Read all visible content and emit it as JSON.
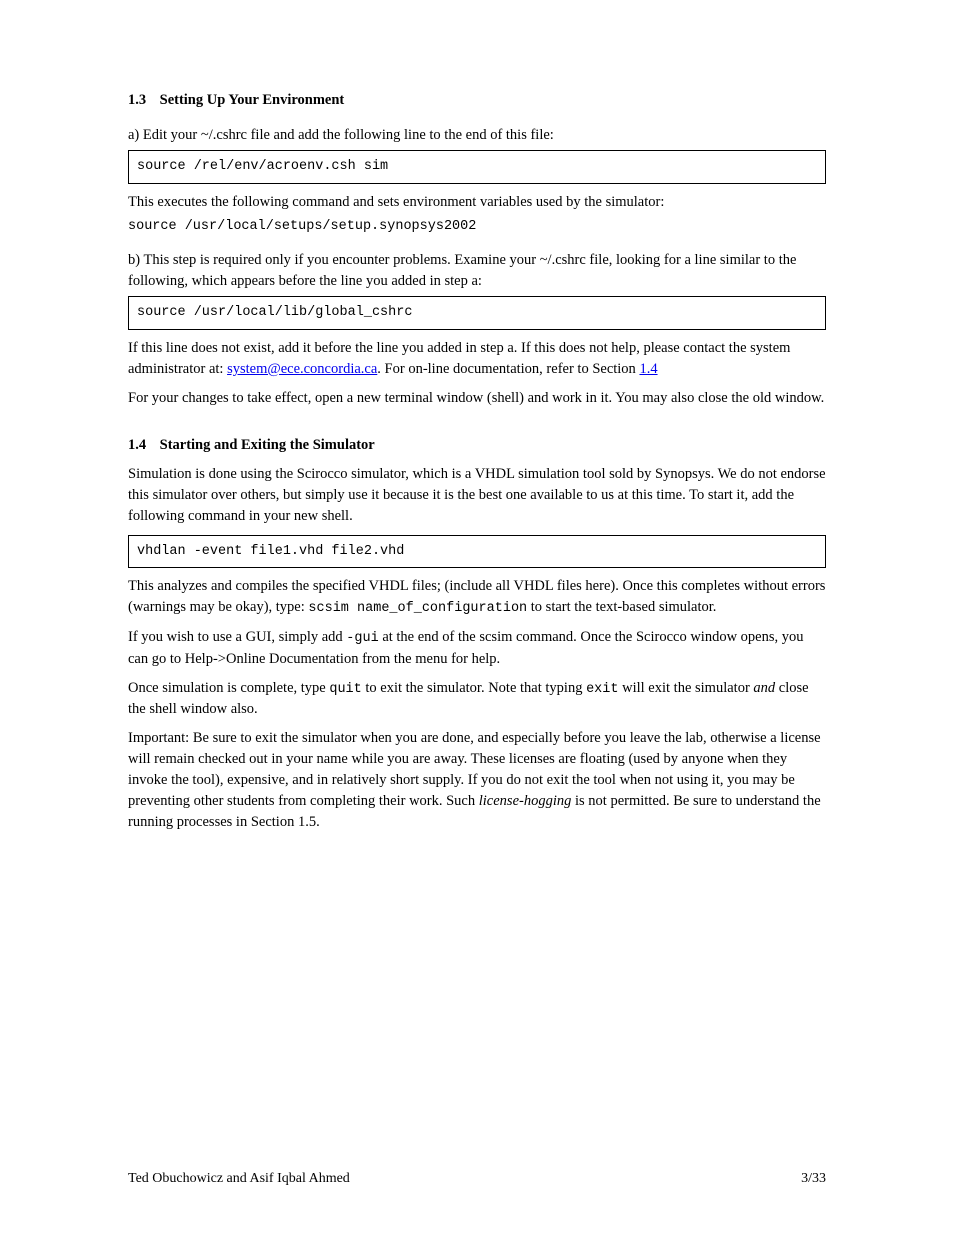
{
  "section3": {
    "number": "1.3",
    "title": "Setting Up Your Environment",
    "step_a": {
      "label": "a)",
      "text": "Edit your ~/.cshrc file and add the following line to the end of this file:"
    },
    "code1": "source /rel/env/acroenv.csh sim",
    "post_code1": "This executes the following command and sets environment variables used by the simulator:",
    "code_inline1": "source /usr/local/setups/setup.synopsys2002",
    "step_b": {
      "label": "b)",
      "text": "This step is required only if you encounter problems. Examine your ~/.cshrc file, looking for a line similar to the following, which appears before the line you added in step a:"
    },
    "code2": "source /usr/local/lib/global_cshrc",
    "post_code2a": "If this line does not exist, add it before the line you added in step a. If this does not help, please contact the system administrator at:",
    "contact_link_text": "system@ece.concordia.ca",
    "contact_link_href": "mailto:system@ece.concordia.ca",
    "post_contact_trailer": ". For on-line documentation, refer to Section",
    "doc_section_ref": "1.4",
    "outro1": "For your changes to take effect, open a new terminal window (shell) and work in it. You may also close the old window."
  },
  "section4": {
    "number": "1.4",
    "title": "Starting and Exiting the Simulator",
    "intro": "Simulation is done using the Scirocco simulator, which is a VHDL simulation tool sold by Synopsys. We do not endorse this simulator over others, but simply use it because it is the best one available to us at this time. To start it, add the following command in your new shell.",
    "code3": "vhdlan -event file1.vhd file2.vhd",
    "para1": "This analyzes and compiles the specified VHDL files; (include all VHDL files here). Once this completes without errors (warnings may be okay), type:",
    "code_inline2": "scsim name_of_configuration",
    "para1b": " to start the text-based simulator.",
    "para2a": "If you wish to use a GUI, simply add ",
    "code_inline3": "-gui",
    "para2b": " at the end of the scsim command. Once the Scirocco window opens, you can go to Help->Online Documentation from the menu for help.",
    "para3a": "Once simulation is complete, type ",
    "code_inline4": "quit",
    "para3b": " to exit the simulator. Note that typing ",
    "code_inline5": "exit",
    "para3c": " will exit the simulator ",
    "italic1": "and",
    "para3d": " close the shell window also.",
    "para4_heading": "Important:",
    "para4_body": " Be sure to exit the simulator when you are done, and especially before you leave the lab, otherwise a license will remain checked out in your name while you are away. These licenses are floating (used by anyone when they invoke the tool), expensive, and in relatively short supply. If you do not exit the tool when not using it, you may be preventing other students from completing their work. Such ",
    "italic2": "license-hogging",
    "para4_trailer": " is not permitted. Be sure to understand the running processes in Section 1.5."
  },
  "footer": {
    "left": "Ted Obuchowicz and Asif Iqbal Ahmed",
    "right": "3/33"
  }
}
